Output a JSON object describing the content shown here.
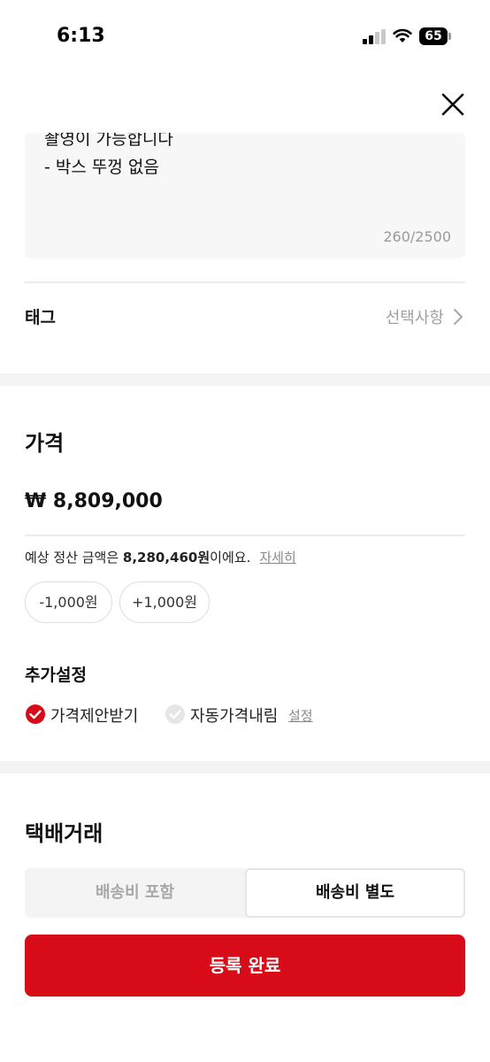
{
  "status_bar": {
    "time": "6:13",
    "battery_level": "65",
    "battery_percent": 65
  },
  "header": {
    "close_icon": "close-icon"
  },
  "description": {
    "cut_line": "촬영이 가능합니다",
    "visible_line": "- 박스 뚜껑 없음",
    "counter": "260/2500"
  },
  "tag": {
    "label": "태그",
    "value": "선택사항"
  },
  "price": {
    "title": "가격",
    "amount": "₩ 8,809,000",
    "settlement_prefix": "예상 정산 금액은 ",
    "settlement_amount": "8,280,460원",
    "settlement_suffix": "이에요.",
    "settlement_link": "자세히",
    "minus_button": "-1,000원",
    "plus_button": "+1,000원"
  },
  "extra_settings": {
    "title": "추가설정",
    "options": [
      {
        "label": "가격제안받기",
        "checked": true
      },
      {
        "label": "자동가격내림",
        "checked": false,
        "link": "설정"
      }
    ]
  },
  "shipping": {
    "title": "택배거래",
    "options": [
      "배송비 포함",
      "배송비 별도"
    ],
    "selected": "배송비 별도"
  },
  "submit_label": "등록 완료",
  "colors": {
    "accent": "#d80c18",
    "muted_text": "#a0a0a0",
    "section_gap": "#f4f4f4"
  }
}
